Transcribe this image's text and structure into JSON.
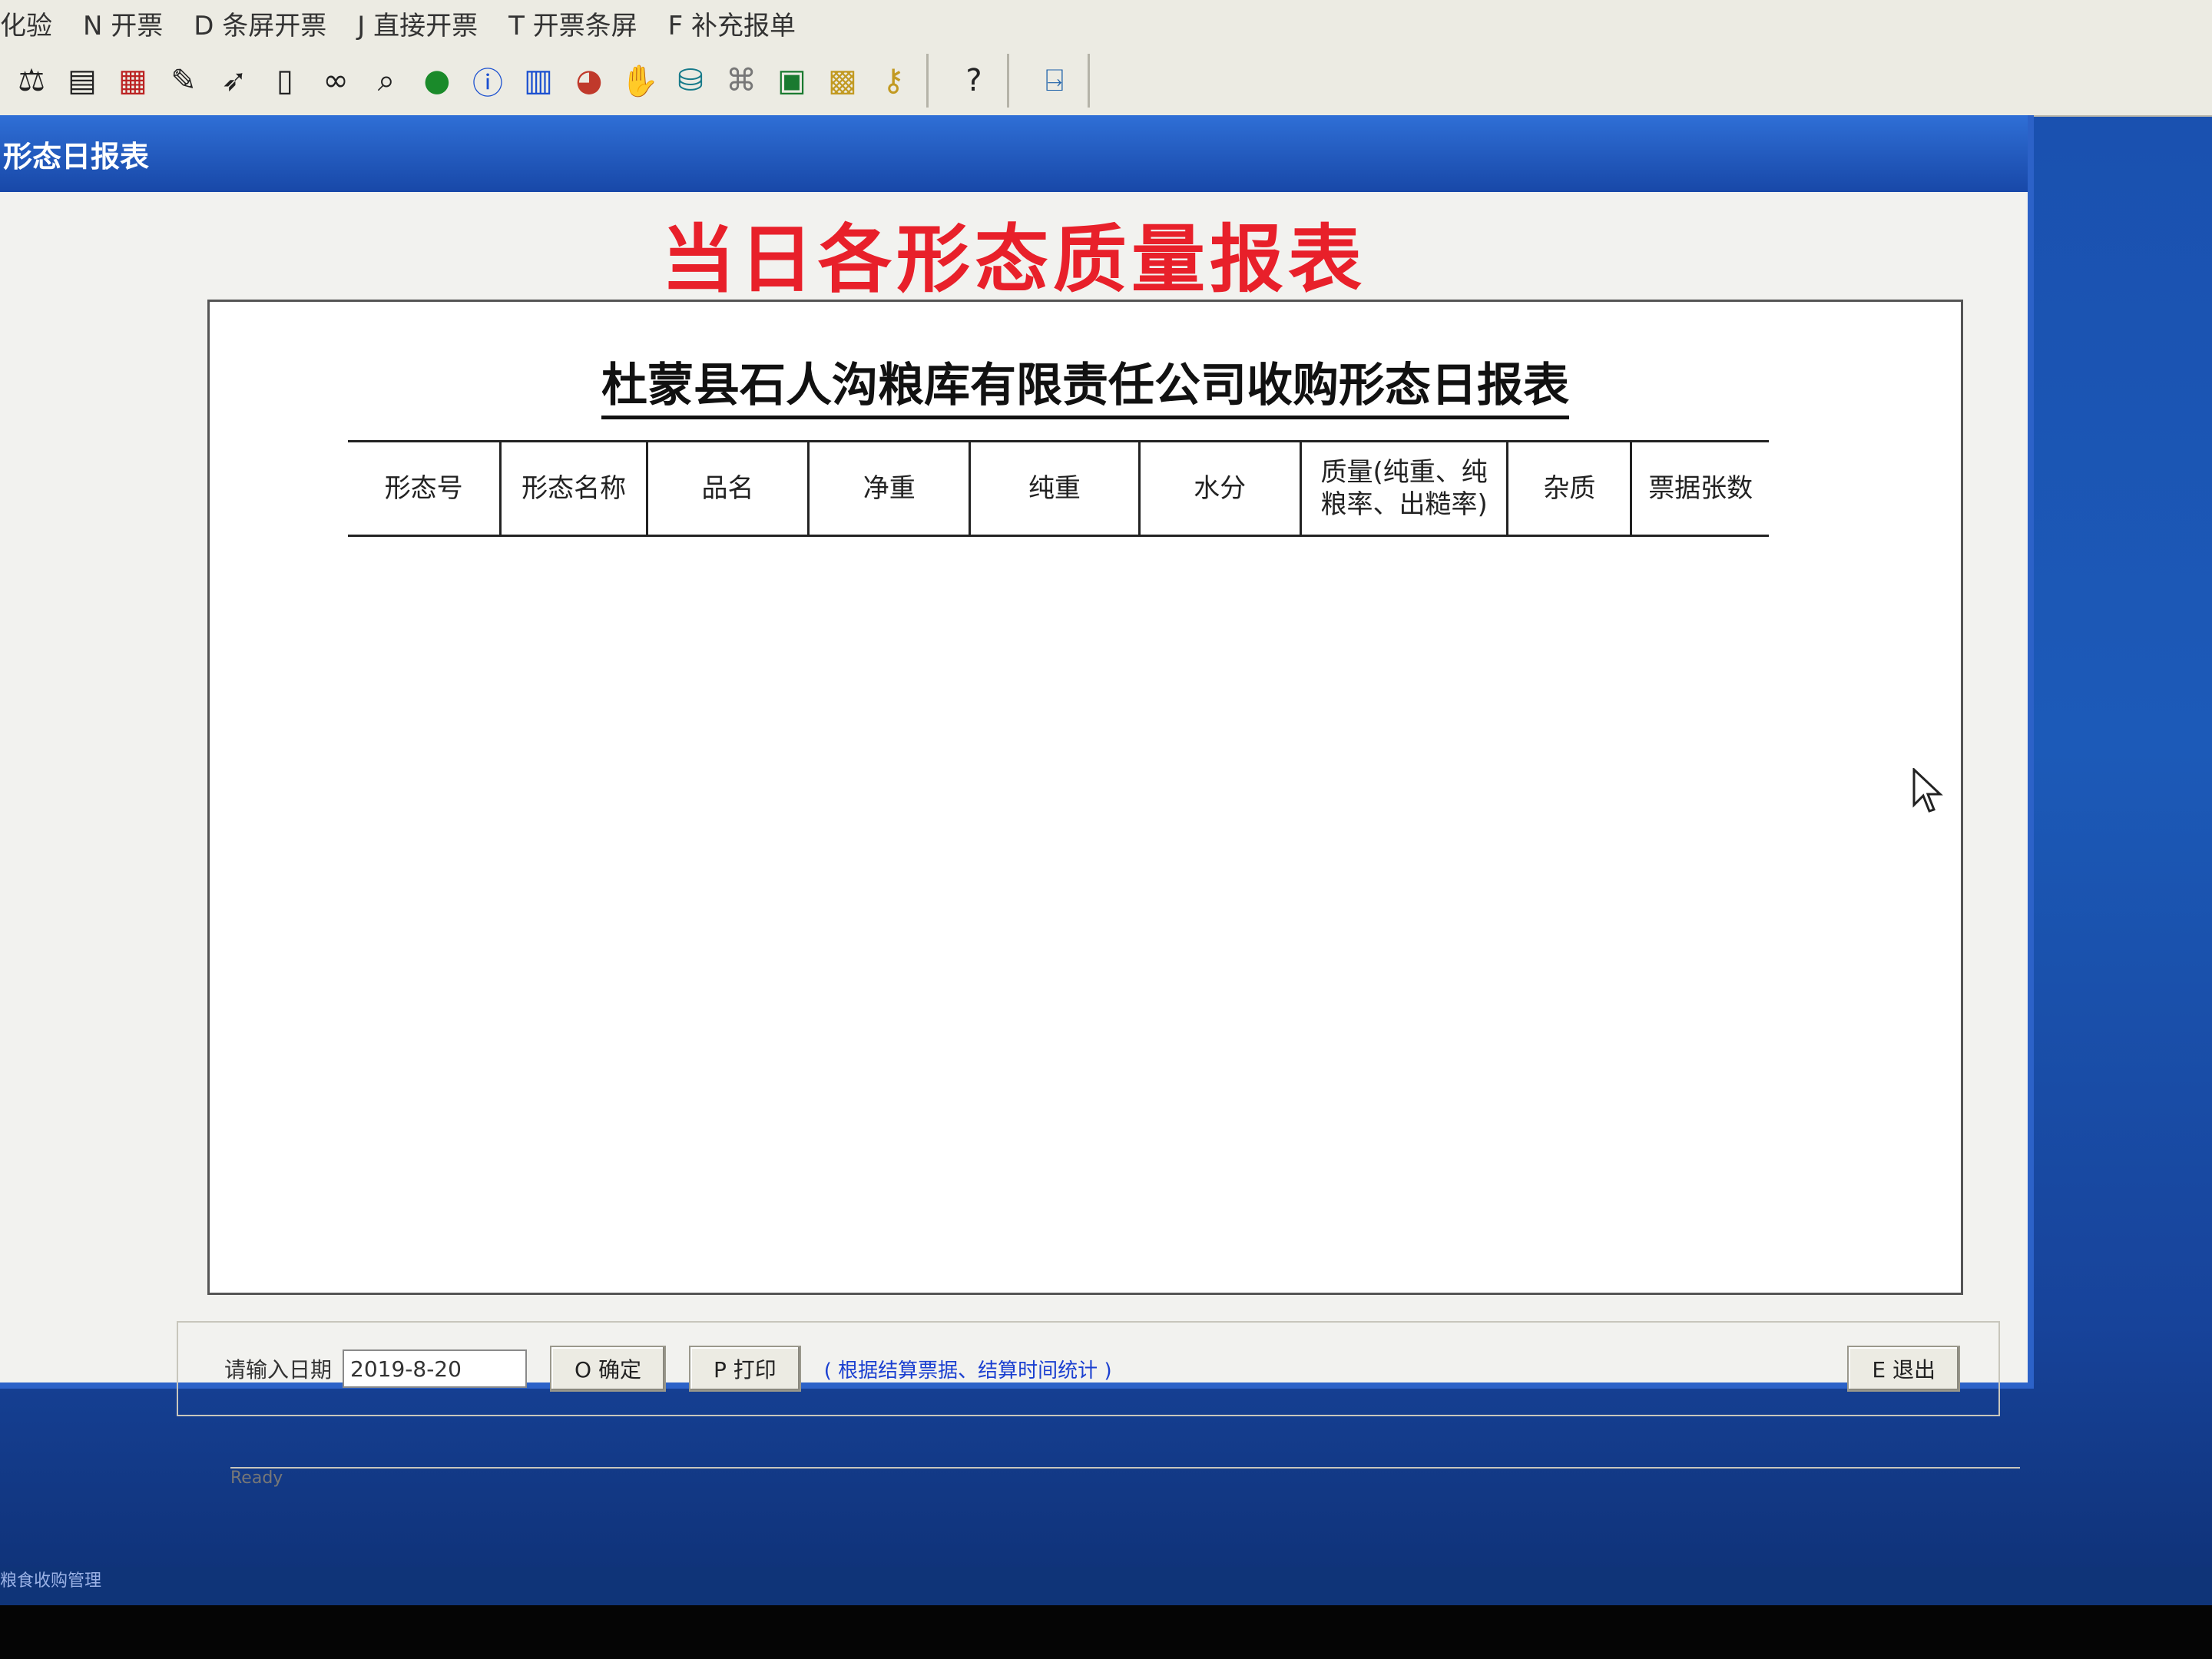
{
  "menu": {
    "items": [
      "化验",
      "N 开票",
      "D 条屏开票",
      "J 直接开票",
      "T 开票条屏",
      "F 补充报单"
    ]
  },
  "toolbar": {
    "icons": [
      "scale-icon",
      "document-icon",
      "grid-icon",
      "pen-icon",
      "pointer-icon",
      "book-icon",
      "binoculars-icon",
      "magnifier-icon",
      "green-check-icon",
      "info-icon",
      "bar-chart-icon",
      "pie-icon",
      "hands-icon",
      "database-icon",
      "network-icon",
      "calculator-icon",
      "help-book-icon",
      "key-icon",
      "help-icon",
      "exit-door-icon"
    ]
  },
  "window": {
    "title": "形态日报表",
    "heading": "当日各形态质量报表",
    "company_title": "杜蒙县石人沟粮库有限责任公司收购形态日报表",
    "columns": [
      "形态号",
      "形态名称",
      "品名",
      "净重",
      "纯重",
      "水分",
      "质量(纯重、纯粮率、出糙率)",
      "杂质",
      "票据张数"
    ]
  },
  "controls": {
    "date_label": "请输入日期",
    "date_value": "2019-8-20",
    "confirm_label": "O 确定",
    "print_label": "P 打印",
    "hint": "( 根据结算票据、结算时间统计 )",
    "exit_label": "E 退出"
  },
  "status": {
    "text": "Ready"
  },
  "taskbar": {
    "text": "粮食收购管理"
  },
  "colors": {
    "heading": "#e8202a",
    "titlebar": "#1848a8",
    "hint": "#1a3fd0",
    "desktop": "#1a4fae"
  }
}
